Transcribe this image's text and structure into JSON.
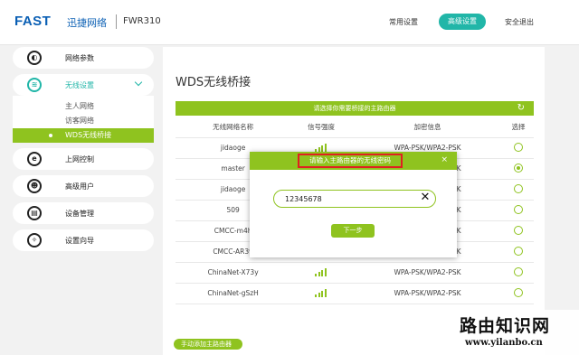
{
  "header": {
    "logo": "FAST",
    "brand": "迅捷网络",
    "model": "FWR310",
    "nav": [
      "常用设置",
      "高级设置",
      "安全退出"
    ]
  },
  "sidebar": {
    "items": [
      {
        "label": "网络参数",
        "icon": "globe-icon"
      },
      {
        "label": "无线设置",
        "icon": "wifi-icon"
      },
      {
        "label": "上网控制",
        "icon": "e-icon"
      },
      {
        "label": "高级用户",
        "icon": "user-icon"
      },
      {
        "label": "设备管理",
        "icon": "device-icon"
      },
      {
        "label": "设置向导",
        "icon": "wizard-icon"
      }
    ],
    "wireless_sub": [
      "主人网络",
      "访客网络",
      "WDS无线桥接"
    ]
  },
  "main": {
    "title": "WDS无线桥接",
    "bar_text": "请选择你需要桥接的主路由器",
    "columns": [
      "无线网络名称",
      "信号强度",
      "加密信息",
      "选择"
    ],
    "rows": [
      {
        "ssid": "jidaoge",
        "enc": "WPA-PSK/WPA2-PSK",
        "selected": false
      },
      {
        "ssid": "master",
        "enc": "WPA-PSK/WPA2-PSK",
        "selected": true
      },
      {
        "ssid": "jidaoge",
        "enc": "WPA-PSK/WPA2-PSK",
        "selected": false
      },
      {
        "ssid": "509",
        "enc": "WPA-PSK/WPA2-PSK",
        "selected": false
      },
      {
        "ssid": "CMCC-m4h",
        "enc": "WPA-PSK/WPA2-PSK",
        "selected": false
      },
      {
        "ssid": "CMCC-AR39",
        "enc": "WPA-PSK/WPA2-PSK",
        "selected": false
      },
      {
        "ssid": "ChinaNet-X73y",
        "enc": "WPA-PSK/WPA2-PSK",
        "selected": false
      },
      {
        "ssid": "ChinaNet-gSzH",
        "enc": "WPA-PSK/WPA2-PSK",
        "selected": false
      }
    ],
    "manual_add": "手动添加主路由器"
  },
  "modal": {
    "title": "请输入主路由器的无线密码",
    "close": "×",
    "password": "12345678",
    "clear": "✕",
    "next": "下一步"
  },
  "watermark": {
    "cn": "路由知识网",
    "url": "www.yilanbo.cn"
  },
  "colors": {
    "green": "#8fc31f",
    "teal": "#21b6a8",
    "logo_blue": "#0a5fb4",
    "highlight_red": "#e02020"
  }
}
